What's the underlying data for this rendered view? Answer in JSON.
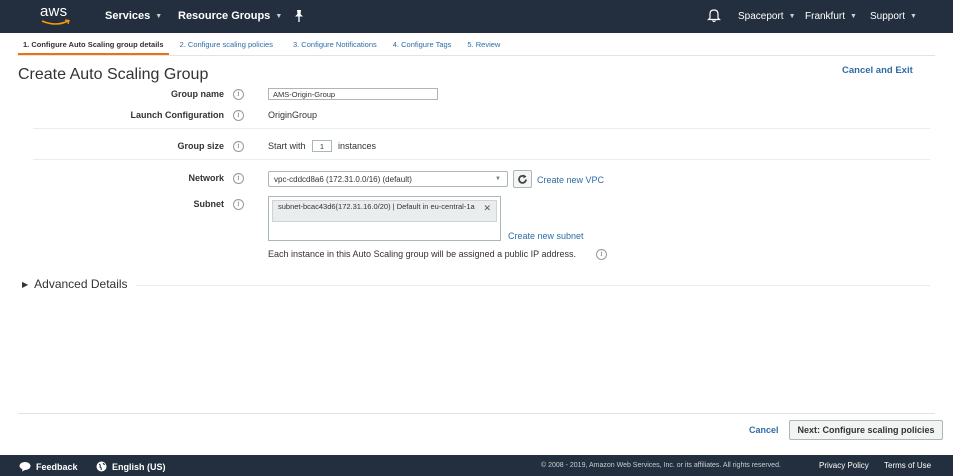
{
  "topnav": {
    "logo_text": "aws",
    "services": "Services",
    "resource_groups": "Resource Groups",
    "account": "Spaceport",
    "region": "Frankfurt",
    "support": "Support"
  },
  "steps": [
    "1. Configure Auto Scaling group details",
    "2. Configure scaling policies",
    "3. Configure Notifications",
    "4. Configure Tags",
    "5. Review"
  ],
  "page": {
    "title": "Create Auto Scaling Group",
    "cancel_exit": "Cancel and Exit"
  },
  "form": {
    "group_name_label": "Group name",
    "group_name_value": "AMS-Origin-Group",
    "launch_config_label": "Launch Configuration",
    "launch_config_value": "OriginGroup",
    "group_size_label": "Group size",
    "group_size_prefix": "Start with",
    "group_size_value": "1",
    "group_size_suffix": "instances",
    "network_label": "Network",
    "network_value": "vpc-cddcd8a6 (172.31.0.0/16) (default)",
    "create_vpc": "Create new VPC",
    "subnet_label": "Subnet",
    "subnet_tag": "subnet-bcac43d6(172.31.16.0/20) | Default in eu-central-1a",
    "create_subnet": "Create new subnet",
    "public_ip_note": "Each instance in this Auto Scaling group will be assigned a public IP address."
  },
  "advanced": "Advanced Details",
  "actions": {
    "cancel": "Cancel",
    "next": "Next: Configure scaling policies"
  },
  "footer": {
    "feedback": "Feedback",
    "language": "English (US)",
    "copyright": "© 2008 - 2019, Amazon Web Services, Inc. or its affiliates. All rights reserved.",
    "privacy": "Privacy Policy",
    "terms": "Terms of Use"
  },
  "colors": {
    "nav_bg": "#232f3e",
    "link": "#2f6ca6",
    "active_tab": "#ec7211"
  }
}
